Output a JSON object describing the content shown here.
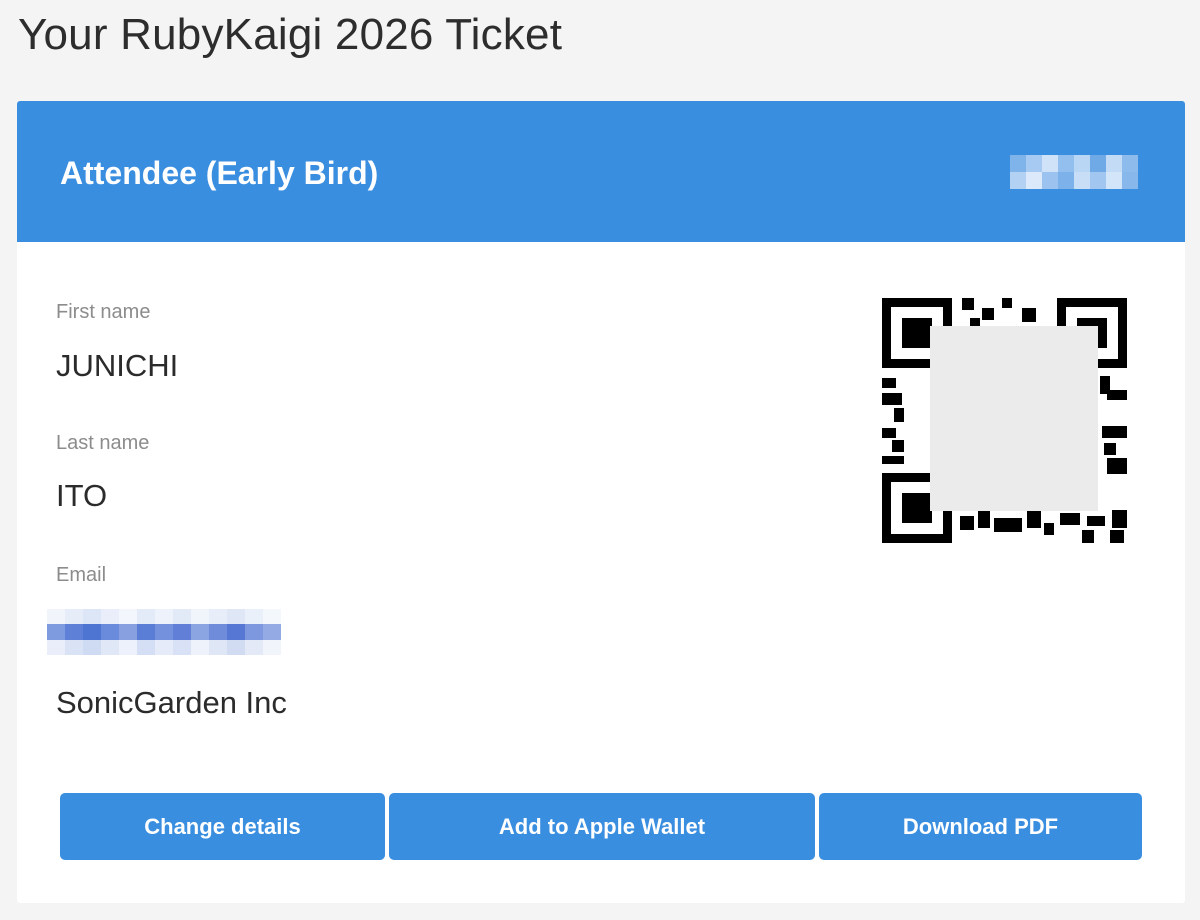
{
  "page": {
    "title": "Your RubyKaigi 2026 Ticket"
  },
  "ticket": {
    "type_label": "Attendee (Early Bird)",
    "code_redacted": true
  },
  "fields": {
    "first_name_label": "First name",
    "first_name_value": "JUNICHI",
    "last_name_label": "Last name",
    "last_name_value": "ITO",
    "email_label": "Email",
    "email_redacted": true,
    "company_value": "SonicGarden Inc"
  },
  "actions": {
    "change_details": "Change details",
    "apple_wallet": "Add to Apple Wallet",
    "download_pdf": "Download PDF"
  },
  "colors": {
    "accent": "#3a8ee0",
    "background": "#f4f4f4",
    "label": "#8c8c8c"
  },
  "icons": {
    "qr": "qr-code"
  }
}
